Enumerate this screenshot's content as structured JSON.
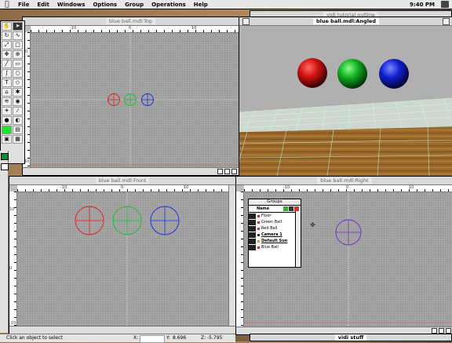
{
  "menubar": {
    "items": [
      "File",
      "Edit",
      "Windows",
      "Options",
      "Group",
      "Operations",
      "Help"
    ],
    "clock": "9:40 PM"
  },
  "windows": {
    "top": {
      "title": "blue ball.mdl:Top"
    },
    "angled": {
      "title": "blue ball.mdl:Angled"
    },
    "tutorial": {
      "title": "vidi tutorial outline"
    },
    "front": {
      "title": "blue ball.mdl:Front"
    },
    "right": {
      "title": "blue ball.mdl:Right"
    },
    "vidistuff": {
      "title": "vidi stuff"
    }
  },
  "rulers": {
    "top_h": [
      "-10",
      "0",
      "10"
    ],
    "top_v": [
      "10",
      "0",
      "-10"
    ],
    "front_h": [
      "-10",
      "0",
      "10"
    ],
    "front_v": [
      "10",
      "0",
      "-10"
    ],
    "right_h": [
      "-10",
      "0",
      "10"
    ]
  },
  "groups_panel": {
    "title": "Groups",
    "header": "Name",
    "items": [
      "Floor",
      "Green Ball",
      "Red Ball",
      "Camera 1",
      "Default Sun",
      "Blue Ball"
    ]
  },
  "status": {
    "hint": "Click an object to select",
    "x_label": "X:",
    "x_value": "",
    "y_label": "Y:",
    "y_value": "8.696",
    "z_label": "Z:",
    "z_value": "-5.795"
  },
  "colors": {
    "red_ball": "#e02020",
    "green_ball": "#20c030",
    "blue_ball": "#2030e0",
    "floor_grid": "#b8ffcc",
    "floor_wood": "#9a6a2a"
  }
}
